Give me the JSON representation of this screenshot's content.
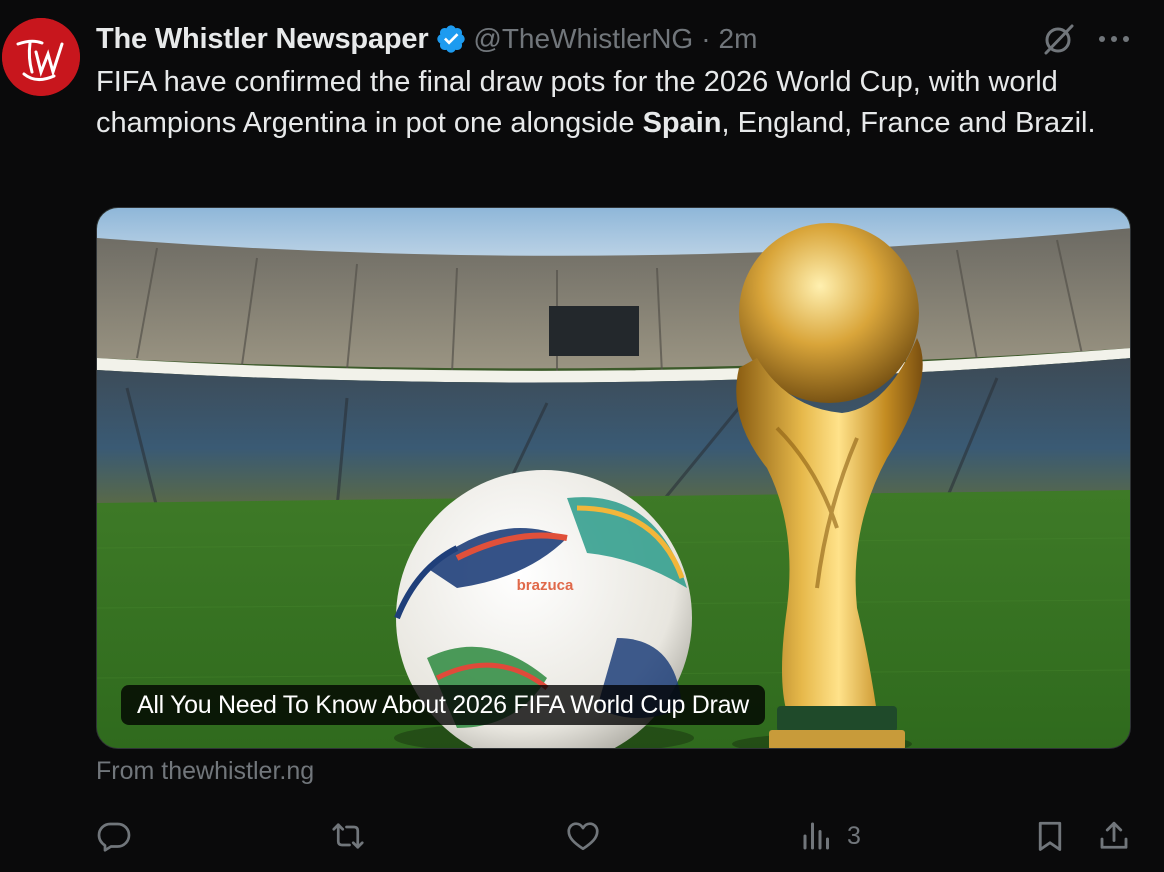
{
  "author": {
    "display_name": "The Whistler Newspaper",
    "handle": "@TheWhistlerNG",
    "separator": "·",
    "time": "2m",
    "avatar_text": "TW",
    "avatar_color": "#c8161d",
    "verified_color": "#1d9bf0"
  },
  "tweet": {
    "text_before": "FIFA have confirmed the final draw pots for the 2026 World Cup, with world champions Argentina in pot one alongside ",
    "text_bold": "Spain",
    "text_after": ", England, France and Brazil."
  },
  "card": {
    "title": "All You Need To Know About 2026 FIFA World Cup Draw",
    "ball_brand": "brazuca",
    "source": "From thewhistler.ng"
  },
  "actions": {
    "reply": {
      "icon": "reply-icon",
      "count": ""
    },
    "repost": {
      "icon": "repost-icon",
      "count": ""
    },
    "like": {
      "icon": "heart-icon",
      "count": ""
    },
    "views": {
      "icon": "views-icon",
      "count": "3"
    },
    "bookmark": {
      "icon": "bookmark-icon"
    },
    "share": {
      "icon": "share-icon"
    }
  },
  "colors": {
    "background": "#0a0a0b",
    "text_primary": "#e7e9ea",
    "text_secondary": "#71767b",
    "accent": "#1d9bf0"
  }
}
